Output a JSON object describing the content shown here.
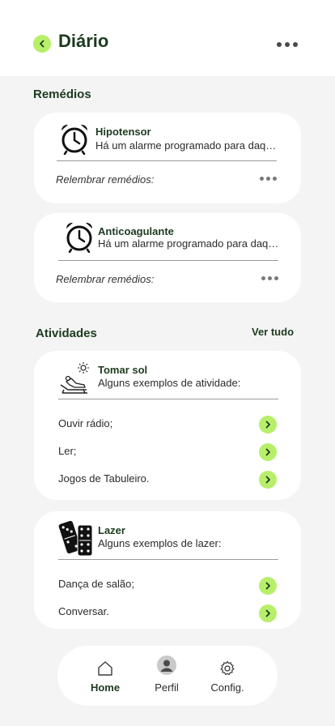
{
  "header": {
    "title": "Diário",
    "back_icon": "chevron-left-icon",
    "more_icon": "more-horizontal-icon"
  },
  "remedios": {
    "section_title": "Remédios",
    "cards": [
      {
        "title": "Hipotensor",
        "subtitle": "Há um alarme programado para daqui...",
        "remind_label": "Relembrar remédios:",
        "icon": "alarm-clock-icon"
      },
      {
        "title": "Anticoagulante",
        "subtitle": "Há um alarme programado para daqui...",
        "remind_label": "Relembrar remédios:",
        "icon": "alarm-clock-icon"
      }
    ]
  },
  "atividades": {
    "section_title": "Atividades",
    "see_all": "Ver tudo",
    "cards": [
      {
        "title": "Tomar sol",
        "subtitle": "Alguns exemplos de atividade:",
        "icon": "sunbathing-icon",
        "items": [
          "Ouvir rádio;",
          "Ler;",
          "Jogos de Tabuleiro."
        ]
      },
      {
        "title": "Lazer",
        "subtitle": "Alguns exemplos de lazer:",
        "icon": "dominoes-icon",
        "items": [
          "Dança de salão;",
          "Conversar."
        ]
      }
    ]
  },
  "nav": {
    "items": [
      {
        "label": "Home",
        "icon": "home-icon",
        "active": true
      },
      {
        "label": "Perfil",
        "icon": "profile-avatar-icon",
        "active": false
      },
      {
        "label": "Config.",
        "icon": "gear-icon",
        "active": false
      }
    ]
  },
  "colors": {
    "accent": "#b7ef6a",
    "title": "#1d3a1f",
    "background": "#f4f4f4"
  }
}
